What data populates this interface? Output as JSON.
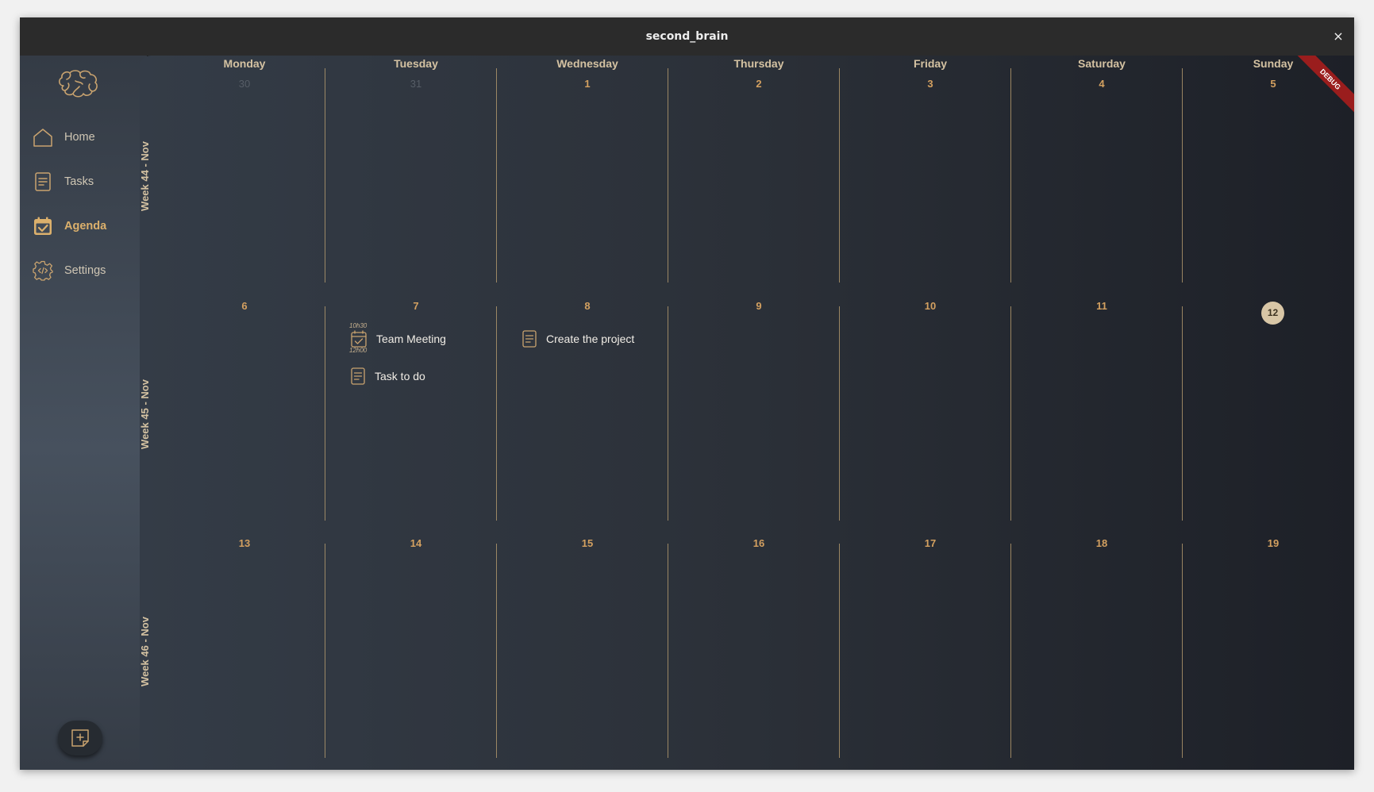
{
  "window": {
    "title": "second_brain",
    "close_glyph": "×"
  },
  "sidebar": {
    "logo_icon": "brain-icon",
    "items": [
      {
        "label": "Home",
        "icon": "home-icon",
        "active": false
      },
      {
        "label": "Tasks",
        "icon": "note-icon",
        "active": false
      },
      {
        "label": "Agenda",
        "icon": "calendar-check-icon",
        "active": true
      },
      {
        "label": "Settings",
        "icon": "gear-code-icon",
        "active": false
      }
    ],
    "add_button_icon": "add-note-icon"
  },
  "calendar": {
    "days": [
      "Monday",
      "Tuesday",
      "Wednesday",
      "Thursday",
      "Friday",
      "Saturday",
      "Sunday"
    ],
    "weeks": [
      {
        "label": "Week 44 - Nov",
        "dates": [
          "30",
          "31",
          "1",
          "2",
          "3",
          "4",
          "5"
        ]
      },
      {
        "label": "Week 45 - Nov",
        "dates": [
          "6",
          "7",
          "8",
          "9",
          "10",
          "11",
          "12"
        ]
      },
      {
        "label": "Week 46 - Nov",
        "dates": [
          "13",
          "14",
          "15",
          "16",
          "17",
          "18",
          "19"
        ]
      }
    ],
    "today": "12",
    "events": {
      "team_meeting": {
        "label": "Team Meeting",
        "start": "10h30",
        "end": "12h00"
      },
      "task_to_do": {
        "label": "Task to do"
      },
      "create_project": {
        "label": "Create the project"
      }
    }
  },
  "debug_banner": "DEBUG",
  "colors": {
    "accent": "#d3a060",
    "text_light": "#d4c2a2",
    "background": "#1f2329"
  }
}
